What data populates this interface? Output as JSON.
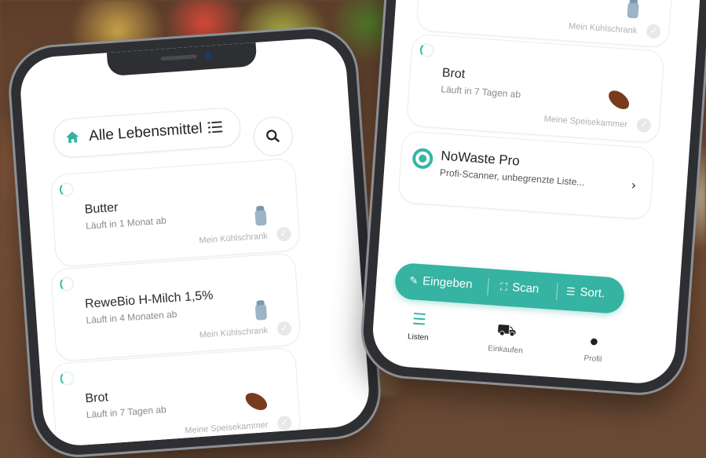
{
  "left_phone": {
    "header": {
      "title": "Alle Lebensmittel"
    },
    "items": [
      {
        "name": "Butter",
        "expiry": "Läuft in 1 Monat ab",
        "location": "Mein Kühlschrank",
        "icon": "fridge-icon"
      },
      {
        "name": "ReweBio H-Milch 1,5%",
        "expiry": "Läuft in 4 Monaten ab",
        "location": "Mein Kühlschrank",
        "icon": "fridge-icon"
      },
      {
        "name": "Brot",
        "expiry": "Läuft in 7 Tagen ab",
        "location": "Meine Speisekammer",
        "icon": "bread-icon"
      }
    ]
  },
  "right_phone": {
    "top_item": {
      "location": "Mein Kühlschrank"
    },
    "bread_item": {
      "name": "Brot",
      "expiry": "Läuft in 7 Tagen ab",
      "location": "Meine Speisekammer"
    },
    "promo": {
      "title": "NoWaste Pro",
      "subtitle": "Profi-Scanner, unbegrenzte Liste..."
    },
    "actions": {
      "enter": "Eingeben",
      "scan": "Scan",
      "sort": "Sort."
    },
    "tabs": {
      "lists": "Listen",
      "shopping": "Einkaufen",
      "profile": "Profil"
    }
  },
  "colors": {
    "accent": "#36b3a2",
    "text": "#222222"
  }
}
